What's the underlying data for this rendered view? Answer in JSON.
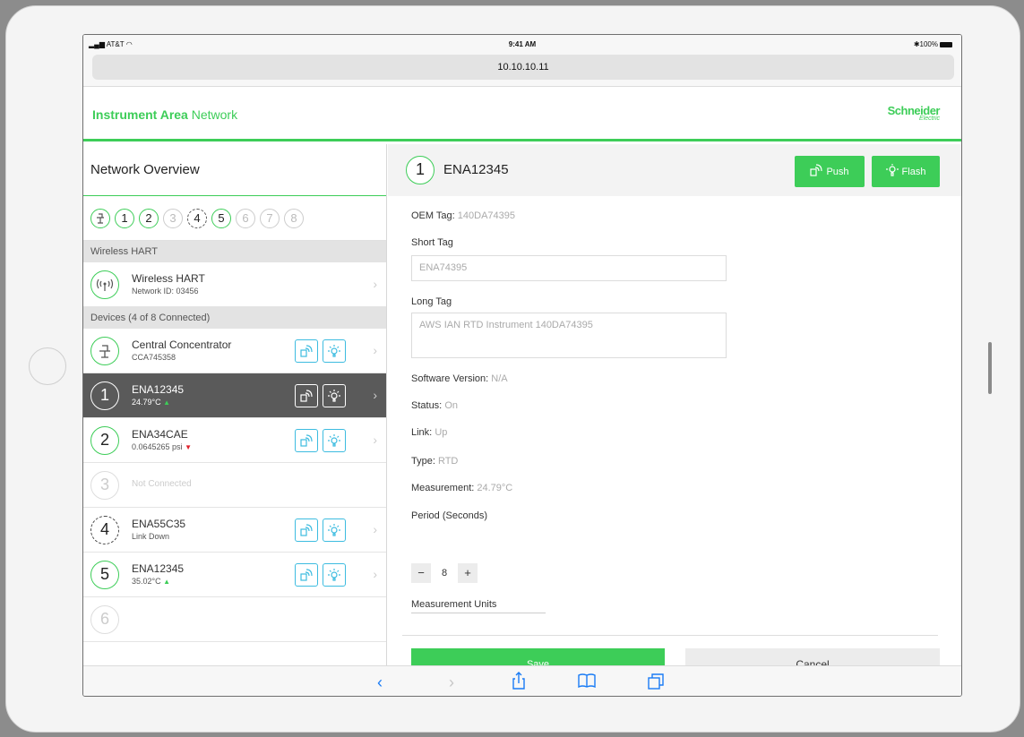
{
  "statusbar": {
    "carrier": "AT&T",
    "time": "9:41 AM",
    "battery": "100%"
  },
  "browser": {
    "url": "10.10.10.11"
  },
  "app": {
    "title_bold": "Instrument Area",
    "title_rest": " Network",
    "logo_line1": "Schneider",
    "logo_line2": "Electric"
  },
  "left": {
    "title": "Network Overview",
    "dots": [
      "1",
      "2",
      "3",
      "4",
      "5",
      "6",
      "7",
      "8"
    ],
    "section_wireless": "Wireless HART",
    "wireless": {
      "name": "Wireless HART",
      "sub": "Network ID: 03456"
    },
    "section_devices": "Devices (4 of 8 Connected)",
    "rows": [
      {
        "badge": "",
        "name": "Central Concentrator",
        "sub": "CCA745358"
      },
      {
        "badge": "1",
        "name": "ENA12345",
        "sub": "24.79°C"
      },
      {
        "badge": "2",
        "name": "ENA34CAE",
        "sub": "0.0645265 psi"
      },
      {
        "badge": "3",
        "notconn": "Not Connected"
      },
      {
        "badge": "4",
        "name": "ENA55C35",
        "sub": "Link Down"
      },
      {
        "badge": "5",
        "name": "ENA12345",
        "sub": "35.02°C"
      },
      {
        "badge": "6"
      }
    ]
  },
  "right": {
    "badge": "1",
    "device_name": "ENA12345",
    "push_label": "Push",
    "flash_label": "Flash",
    "oem_label": "OEM Tag:",
    "oem_value": "140DA74395",
    "short_tag_label": "Short Tag",
    "short_tag_value": "ENA74395",
    "long_tag_label": "Long Tag",
    "long_tag_value": "AWS IAN RTD Instrument 140DA74395",
    "software_label": "Software Version:",
    "software_value": "N/A",
    "status_label": "Status:",
    "status_value": "On",
    "link_label": "Link:",
    "link_value": "Up",
    "type_label": "Type:",
    "type_value": "RTD",
    "measurement_label": "Measurement:",
    "measurement_value": "24.79°C",
    "period_label": "Period (Seconds)",
    "period_value": "8",
    "minus": "−",
    "plus": "+",
    "units_label": "Measurement Units",
    "save_label": "Save",
    "cancel_label": "Cancel"
  },
  "toolbar_icons": [
    "back-icon",
    "forward-icon",
    "share-icon",
    "bookmarks-icon",
    "tabs-icon"
  ],
  "colors": {
    "accent": "#3dcd58",
    "action_border": "#3dbce0",
    "selected_row": "#5a5a5a",
    "trend_down": "#e0212b"
  }
}
